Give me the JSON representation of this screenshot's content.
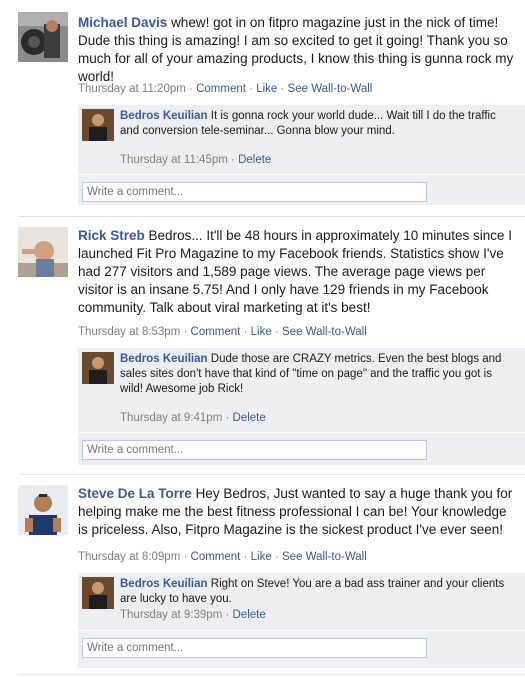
{
  "posts": [
    {
      "author": "Michael Davis",
      "message": "whew! got in on fitpro magazine just in the nick of time! Dude this thing is amazing! I am so excited to get it going! Thank you so much for all of your amazing products, I know this thing is gunna rock my world!",
      "timestamp": "Thursday at 11:20pm",
      "comment_link": "Comment",
      "like_link": "Like",
      "wall_link": "See Wall-to-Wall",
      "reply": {
        "author": "Bedros Keuilian",
        "message": "It is gonna rock your world dude... Wait till I do the traffic and conversion tele-seminar... Gonna blow your mind.",
        "timestamp": "Thursday at 11:45pm",
        "delete_link": "Delete"
      },
      "comment_placeholder": "Write a comment..."
    },
    {
      "author": "Rick Streb",
      "message": "Bedros... It'll be 48 hours in approximately 10 minutes since I launched Fit Pro Magazine to my Facebook friends. Statistics show I've had 277 visitors and 1,589 page views. The average page views per visitor is an insane 5.75! And I only have 129 friends in my Facebook community. Talk about viral marketing at it's best!",
      "timestamp": "Thursday at 8:53pm",
      "comment_link": "Comment",
      "like_link": "Like",
      "wall_link": "See Wall-to-Wall",
      "reply": {
        "author": "Bedros Keuilian",
        "message": "Dude those are CRAZY metrics. Even the best blogs and sales sites don't have that kind of \"time on page\" and the traffic you got is wild! Awesome job Rick!",
        "timestamp": "Thursday at 9:41pm",
        "delete_link": "Delete"
      },
      "comment_placeholder": "Write a comment..."
    },
    {
      "author": "Steve De La Torre",
      "message": "Hey Bedros, Just wanted to say a huge thank you for helping make me the best fitness professional I can be! Your knowledge is priceless. Also, Fitpro Magazine is the sickest product I've ever seen!",
      "timestamp": "Thursday at 8:09pm",
      "comment_link": "Comment",
      "like_link": "Like",
      "wall_link": "See Wall-to-Wall",
      "reply": {
        "author": "Bedros Keuilian",
        "message": "Right on Steve! You are a bad ass trainer and your clients are lucky to have you.",
        "timestamp": "Thursday at 9:39pm",
        "delete_link": "Delete"
      },
      "comment_placeholder": "Write a comment..."
    }
  ],
  "separator": "·",
  "colors": {
    "link": "#3b5998",
    "comment_bg": "#edeff4",
    "meta": "#808080"
  }
}
